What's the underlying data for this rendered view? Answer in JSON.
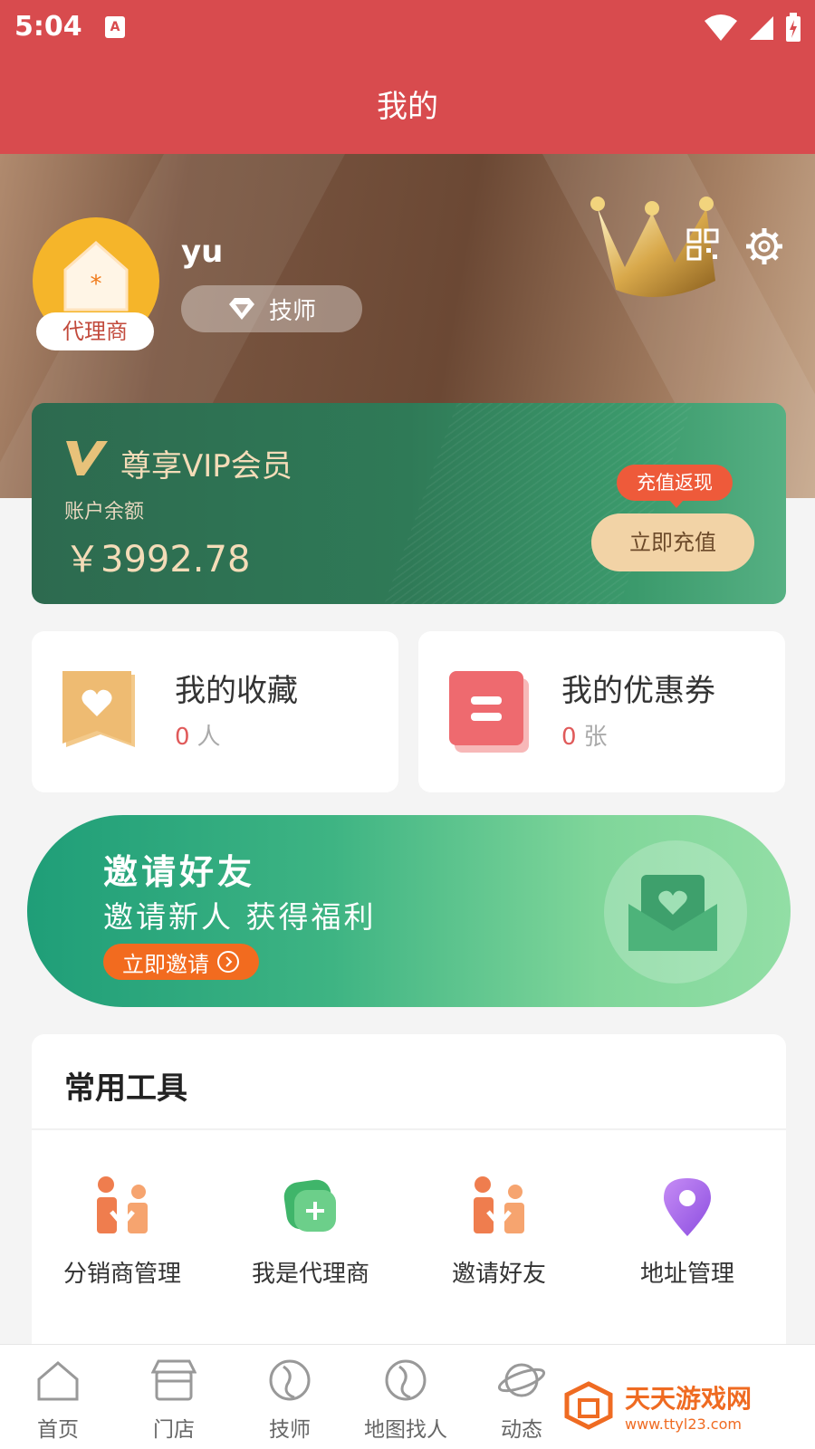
{
  "status_bar": {
    "time": "5:04",
    "app_badge": "A"
  },
  "header": {
    "title": "我的"
  },
  "profile": {
    "username": "yu",
    "agent_tag": "代理商",
    "role": "技师"
  },
  "vip": {
    "title": "尊享VIP会员",
    "balance_label": "账户余额",
    "balance_value": "￥3992.78",
    "recharge_tag": "充值返现",
    "recharge_button": "立即充值"
  },
  "stats": {
    "favorites": {
      "label": "我的收藏",
      "count": "0",
      "unit": "人"
    },
    "coupons": {
      "label": "我的优惠券",
      "count": "0",
      "unit": "张"
    }
  },
  "invite": {
    "title": "邀请好友",
    "subtitle": "邀请新人 获得福利",
    "button": "立即邀请"
  },
  "tools": {
    "title": "常用工具",
    "items": [
      {
        "label": "分销商管理",
        "icon": "people-icon"
      },
      {
        "label": "我是代理商",
        "icon": "agent-plus-icon"
      },
      {
        "label": "邀请好友",
        "icon": "people-icon"
      },
      {
        "label": "地址管理",
        "icon": "location-pin-icon"
      }
    ]
  },
  "tabbar": {
    "items": [
      {
        "label": "首页",
        "icon": "home-icon"
      },
      {
        "label": "门店",
        "icon": "store-icon"
      },
      {
        "label": "技师",
        "icon": "technician-icon"
      },
      {
        "label": "地图找人",
        "icon": "map-person-icon"
      },
      {
        "label": "动态",
        "icon": "planet-icon"
      }
    ]
  },
  "watermark": {
    "name": "天天游戏网",
    "url": "www.ttyl23.com"
  },
  "colors": {
    "header_red": "#d84b4e",
    "vip_green": "#2f7a57",
    "gold_text": "#f4dcb8",
    "invite_green": "#3eb483",
    "accent_orange": "#f26b1f"
  }
}
